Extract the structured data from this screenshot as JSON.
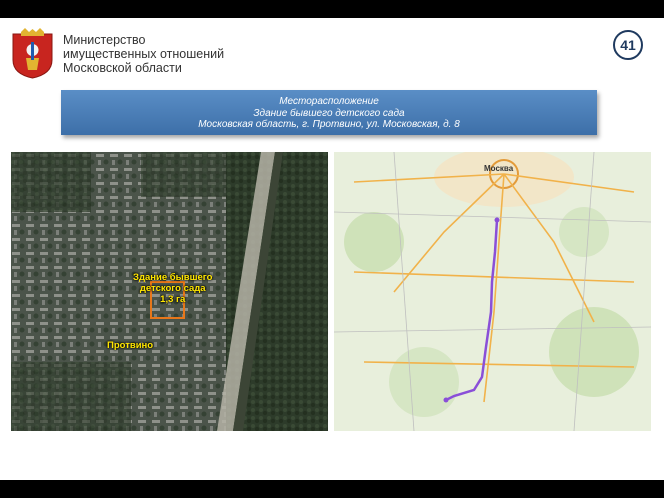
{
  "header": {
    "ministry_line1": "Министерство",
    "ministry_line2": "имущественных отношений",
    "ministry_line3": "Московской области",
    "page_number": "41"
  },
  "banner": {
    "line1": "Месторасположение",
    "line2": "Здание бывшего детского сада",
    "line3": "Московская область, г. Протвино, ул. Московская, д. 8"
  },
  "satellite": {
    "building_label_line1": "Здание бывшего",
    "building_label_line2": "детского сада",
    "area_label": "1,3 га",
    "town_label": "Протвино"
  },
  "map": {
    "city_label": "Москва"
  },
  "colors": {
    "banner": "#4a7eb8",
    "label": "#ffe600",
    "route": "#8a4fd8",
    "plot": "#e8771a"
  }
}
